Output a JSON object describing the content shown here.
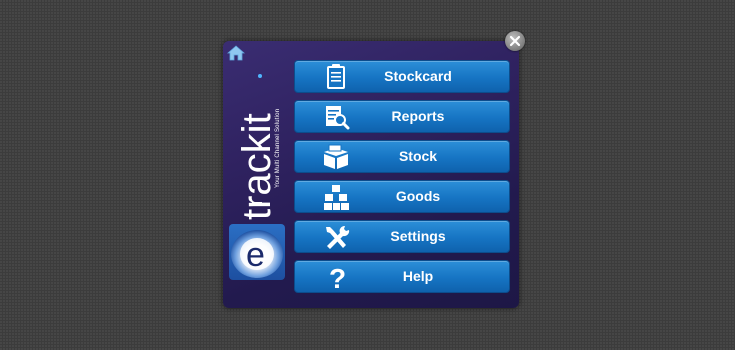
{
  "brand": {
    "wordmark": "trackit",
    "tagline": "Your Multi Channel Solution",
    "logo_letter": "e"
  },
  "menu": {
    "items": [
      {
        "label": "Stockcard",
        "icon": "clipboard-icon"
      },
      {
        "label": "Reports",
        "icon": "report-search-icon"
      },
      {
        "label": "Stock",
        "icon": "stock-box-icon"
      },
      {
        "label": "Goods",
        "icon": "goods-boxes-icon"
      },
      {
        "label": "Settings",
        "icon": "tools-icon"
      },
      {
        "label": "Help",
        "icon": "question-icon"
      }
    ]
  },
  "colors": {
    "button": "#1674c3",
    "panel": "#2f2260",
    "home_icon": "#8fc7f0"
  }
}
